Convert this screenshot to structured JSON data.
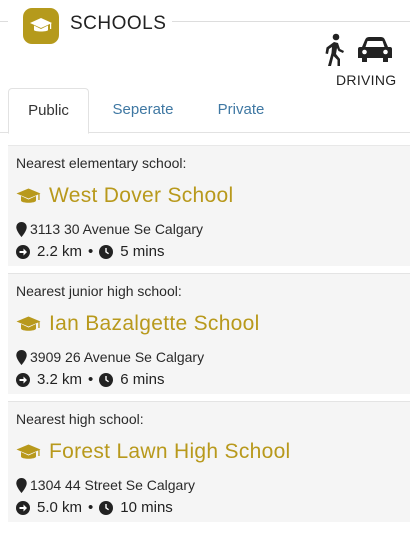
{
  "header": {
    "title": "SCHOOLS",
    "mode_label": "DRIVING",
    "accent_color": "#b59a1c",
    "icons": [
      "graduation-cap-icon",
      "walking-icon",
      "car-icon"
    ]
  },
  "tabs": [
    {
      "label": "Public",
      "active": true
    },
    {
      "label": "Seperate",
      "active": false
    },
    {
      "label": "Private",
      "active": false
    }
  ],
  "schools": [
    {
      "label": "Nearest elementary school:",
      "name": "West Dover School",
      "address": "3113 30 Avenue Se Calgary",
      "distance": "2.2 km",
      "time": "5 mins"
    },
    {
      "label": "Nearest junior high school:",
      "name": "Ian Bazalgette School",
      "address": "3909 26 Avenue Se Calgary",
      "distance": "3.2 km",
      "time": "6 mins"
    },
    {
      "label": "Nearest high school:",
      "name": "Forest Lawn High School",
      "address": "1304 44 Street Se Calgary",
      "distance": "5.0 km",
      "time": "10 mins"
    }
  ],
  "separator": "•"
}
